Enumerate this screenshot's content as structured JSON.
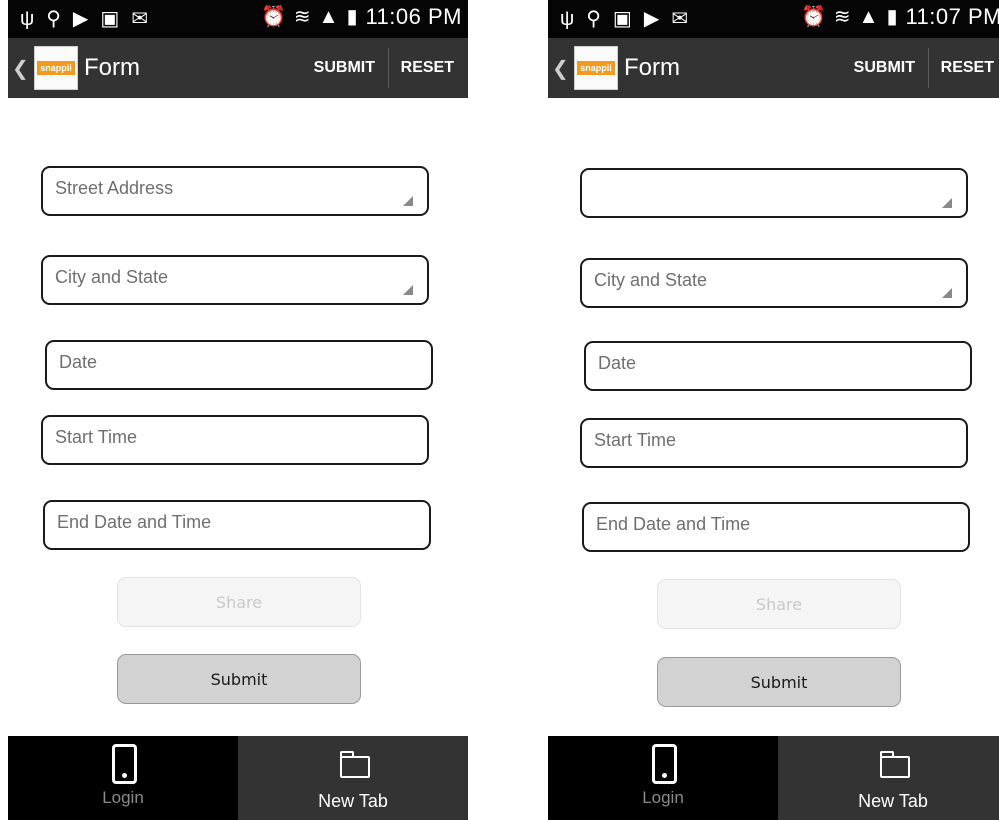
{
  "screens": [
    {
      "status": {
        "time": "11:06 PM"
      },
      "actionbar": {
        "back": "❮",
        "logo_text": "snappii",
        "title": "Form",
        "submit": "SUBMIT",
        "reset": "RESET"
      },
      "form": {
        "street": "Street Address",
        "city": "City and State",
        "date": "Date",
        "start": "Start Time",
        "end": "End Date and Time",
        "share_btn": "Share",
        "submit_btn": "Submit"
      },
      "tabs": {
        "login": "Login",
        "newtab": "New Tab"
      }
    },
    {
      "status": {
        "time": "11:07 PM"
      },
      "actionbar": {
        "back": "❮",
        "logo_text": "snappii",
        "title": "Form",
        "submit": "SUBMIT",
        "reset": "RESET"
      },
      "form": {
        "street": "",
        "city": "City and State",
        "date": "Date",
        "start": "Start Time",
        "end": "End Date and Time",
        "share_btn": "Share",
        "submit_btn": "Submit"
      },
      "tabs": {
        "login": "Login",
        "newtab": "New Tab"
      }
    }
  ],
  "status_icons": [
    "usb-icon",
    "location-icon",
    "youtube-icon",
    "gallery-icon",
    "email-icon",
    "alarm-icon",
    "wifi-icon",
    "signal-icon",
    "battery-icon"
  ],
  "colors": {
    "status_bar": "#050505",
    "action_bar": "#333333",
    "logo_accent": "#f29a1d",
    "tab_active": "#000000",
    "tab_inactive": "#333333"
  }
}
